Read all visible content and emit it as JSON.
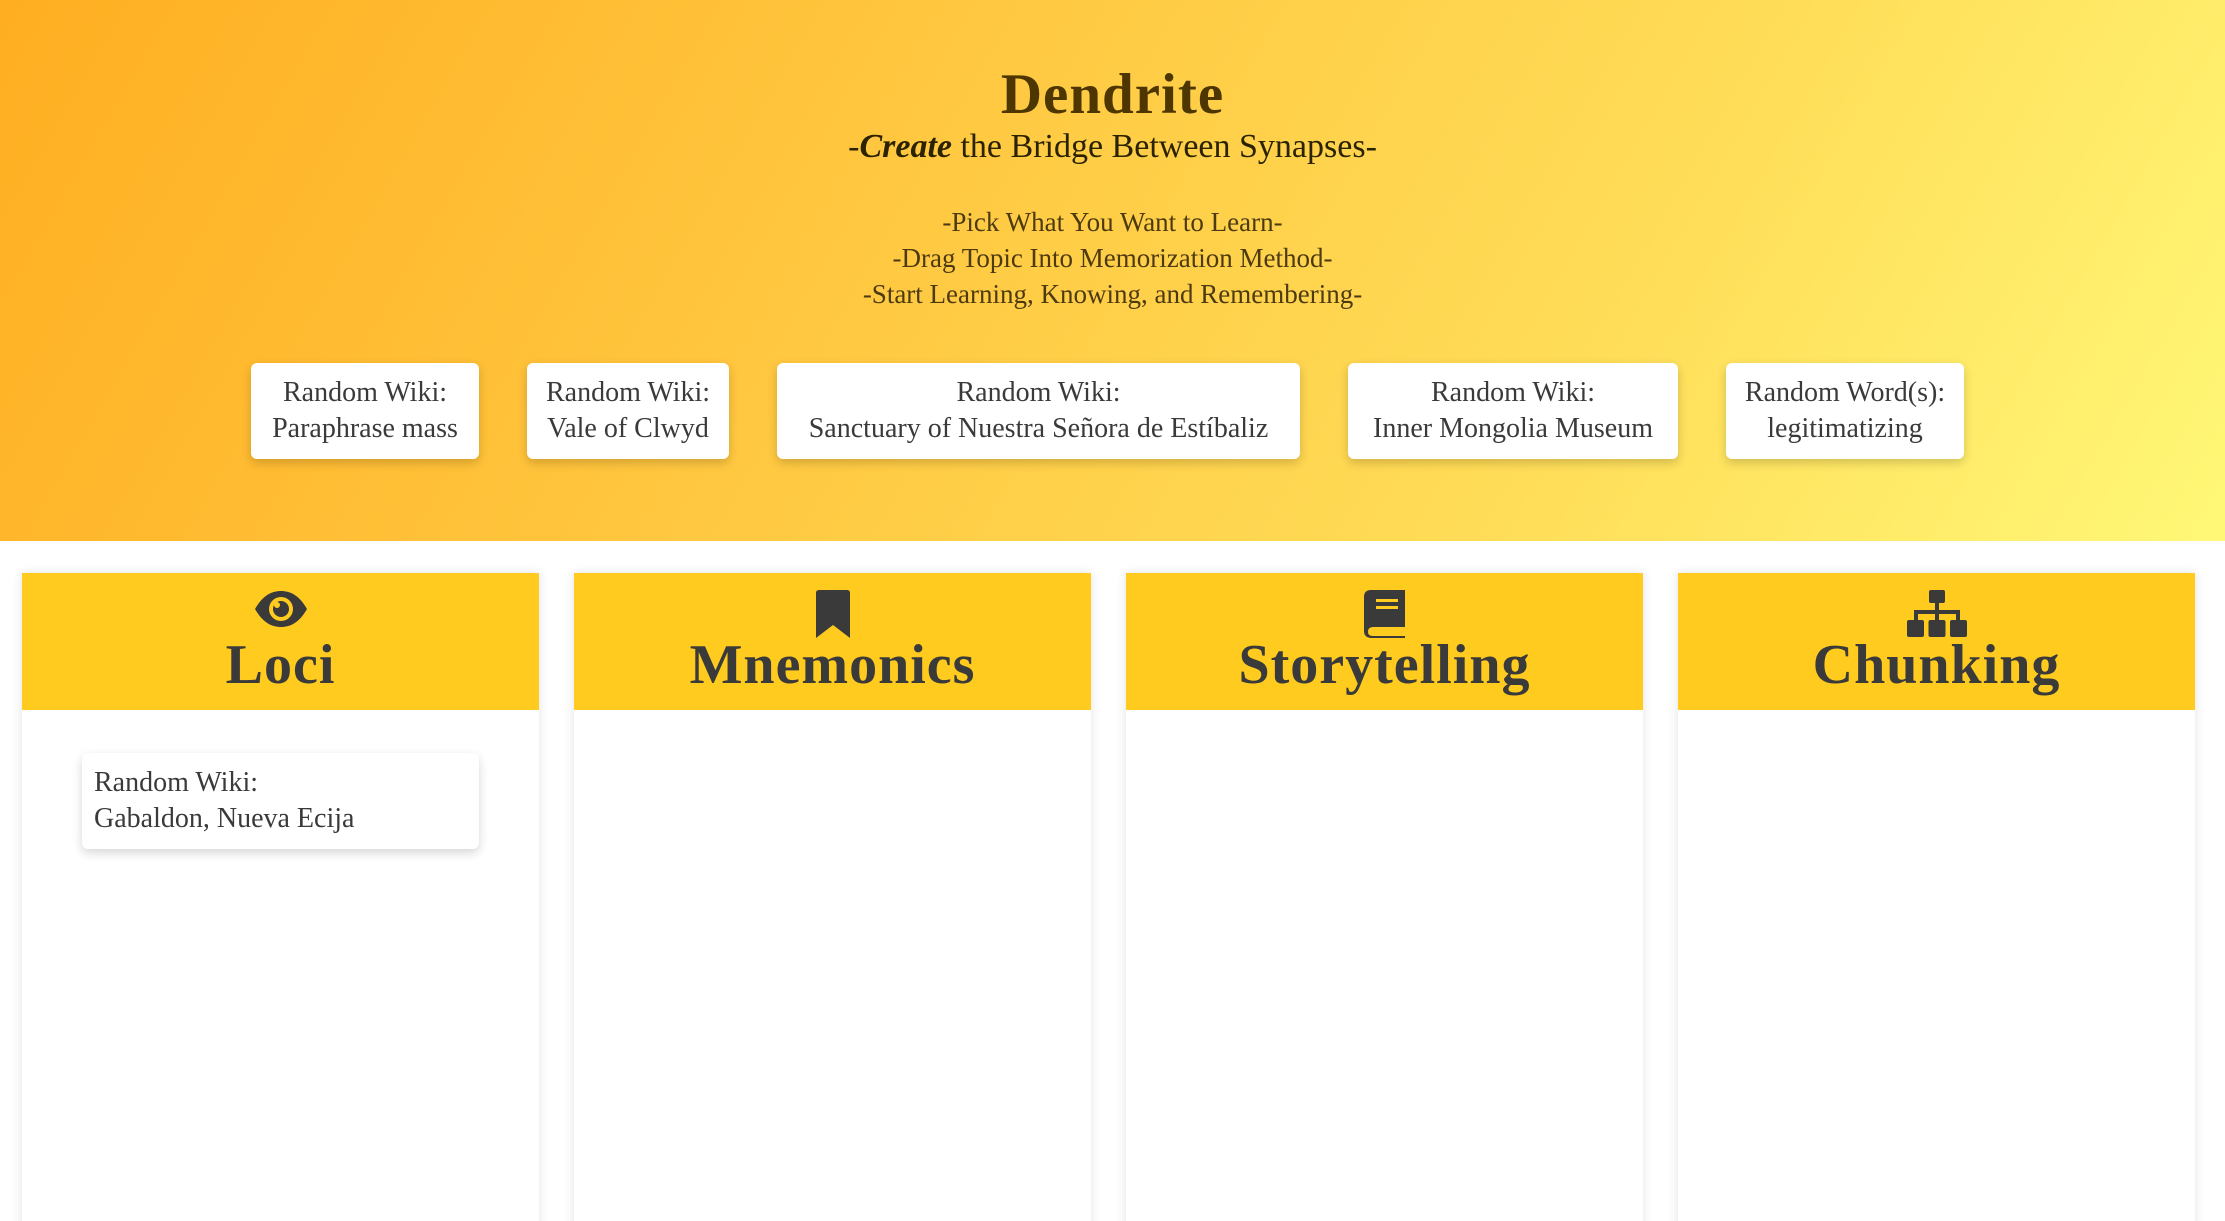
{
  "app": {
    "title": "Dendrite",
    "subtitle_prefix": "-",
    "subtitle_emphasis": "Create",
    "subtitle_rest": " the Bridge Between Synapses-"
  },
  "instructions": [
    "-Pick What You Want to Learn-",
    "-Drag Topic Into Memorization Method-",
    "-Start Learning, Knowing, and Remembering-"
  ],
  "topics": [
    {
      "label": "Random Wiki:",
      "value": "Paraphrase mass"
    },
    {
      "label": "Random Wiki:",
      "value": "Vale of Clwyd"
    },
    {
      "label": "Random Wiki:",
      "value": "Sanctuary of Nuestra Señora de Estíbaliz"
    },
    {
      "label": "Random Wiki:",
      "value": "Inner Mongolia Museum"
    },
    {
      "label": "Random Word(s):",
      "value": "legitimatizing"
    }
  ],
  "methods": [
    {
      "title": "Loci",
      "icon": "eye-icon"
    },
    {
      "title": "Mnemonics",
      "icon": "bookmark-icon"
    },
    {
      "title": "Storytelling",
      "icon": "book-icon"
    },
    {
      "title": "Chunking",
      "icon": "sitemap-icon"
    }
  ],
  "placed_cards": {
    "loci": [
      {
        "label": "Random Wiki:",
        "value": "Gabaldon, Nueva Ecija"
      }
    ]
  },
  "colors": {
    "hero_gradient_start": "#ffae21",
    "hero_gradient_end": "#fff877",
    "column_header": "#ffcb1f",
    "title_text": "#4d3600",
    "icon": "#3a3a3a"
  }
}
